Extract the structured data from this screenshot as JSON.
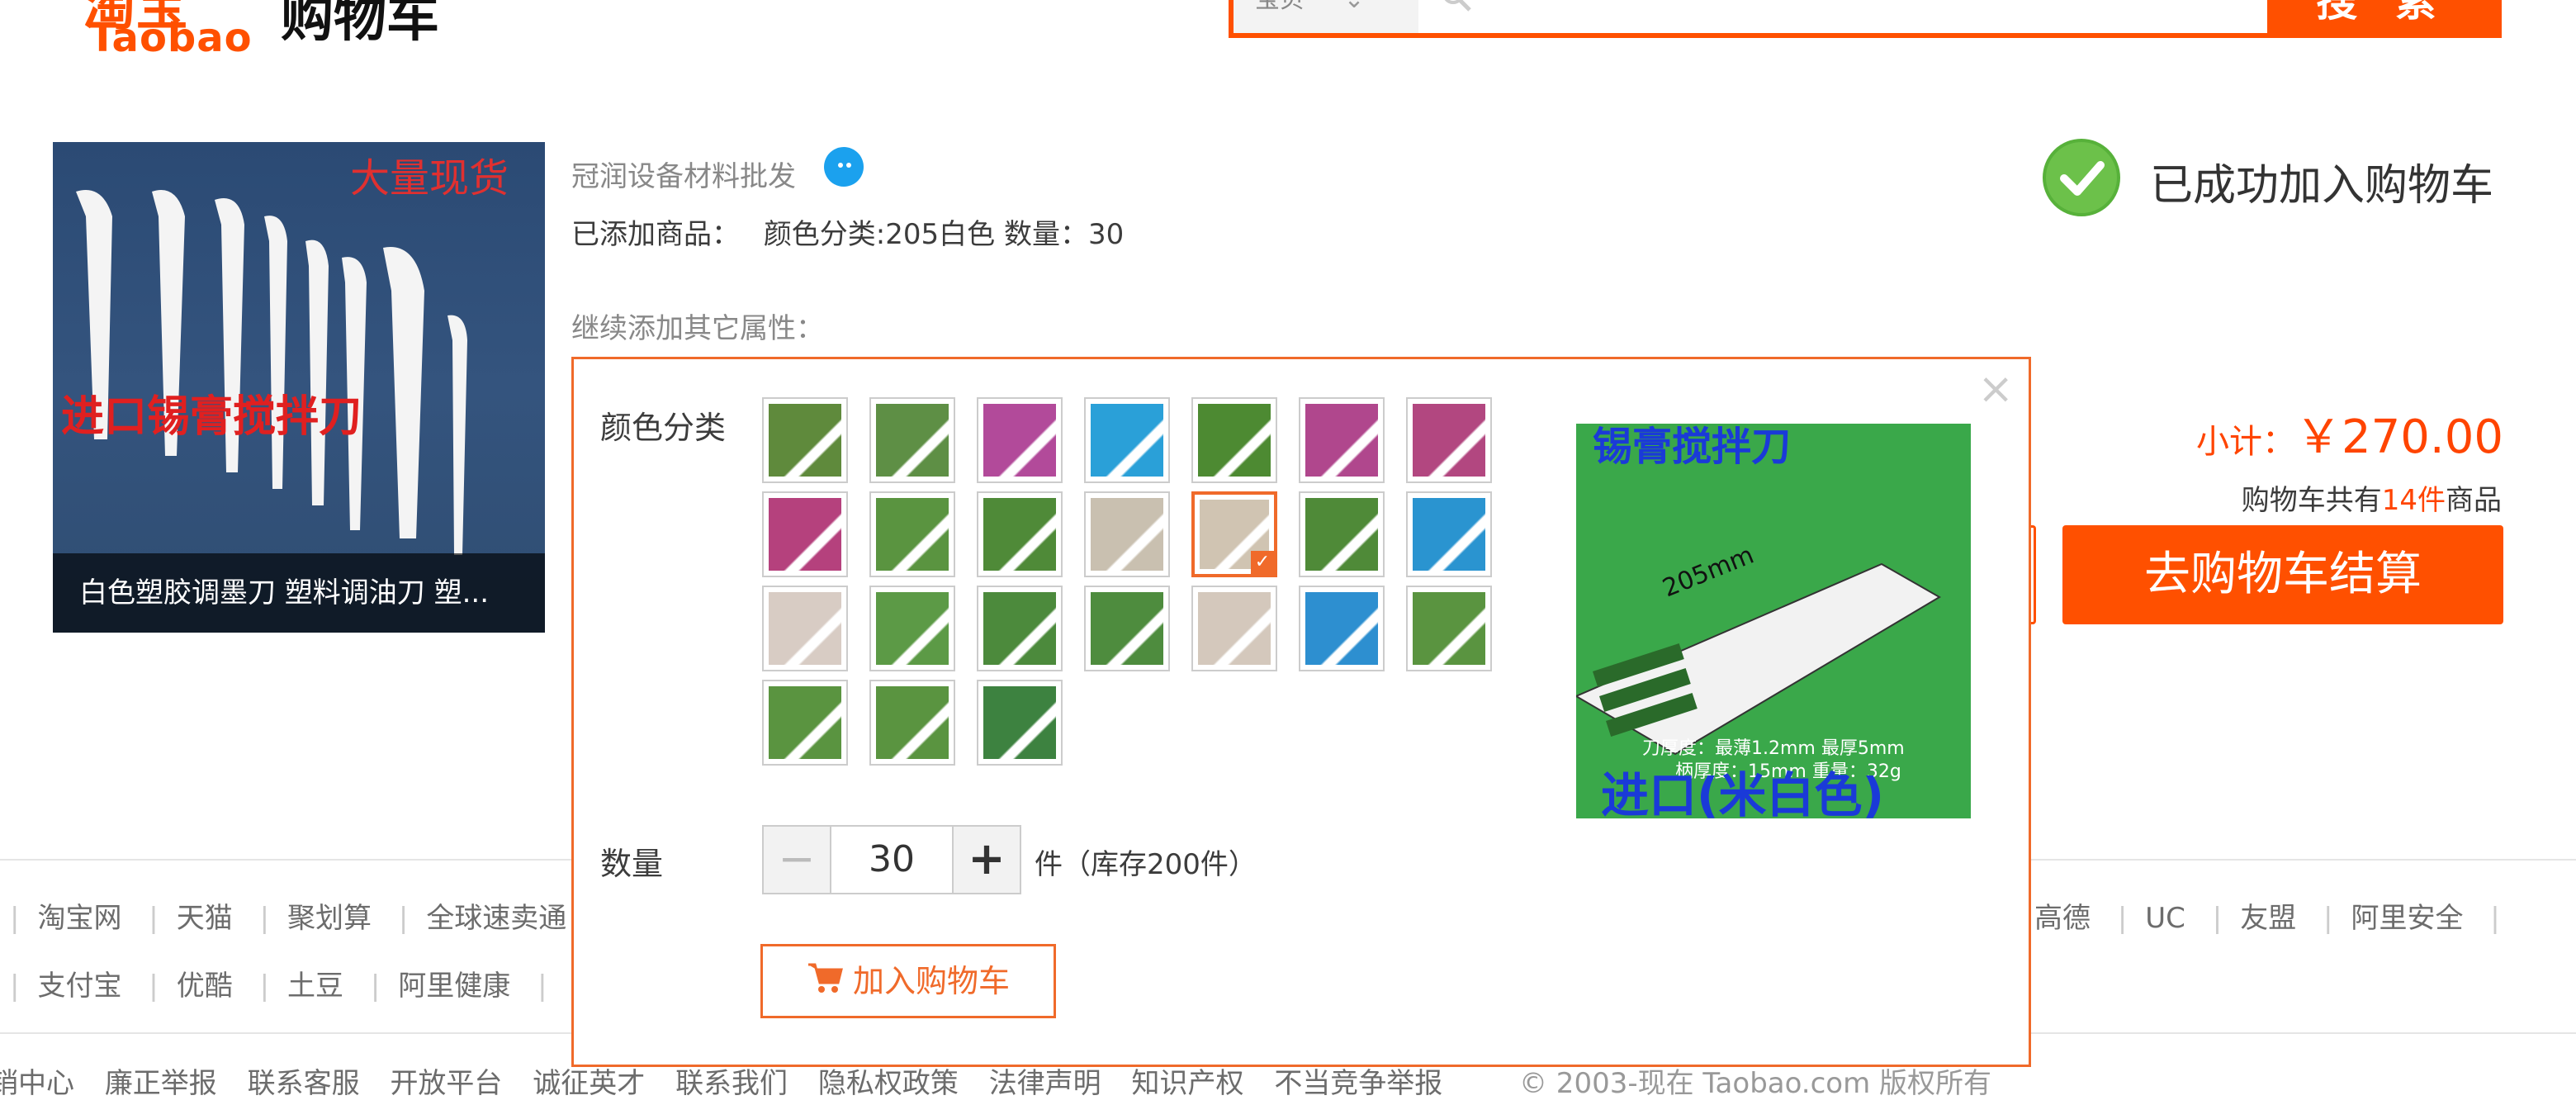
{
  "header": {
    "logo_en": "Taobao",
    "logo_cart": "购物车",
    "search_category": "宝贝",
    "search_button": "搜 索"
  },
  "product": {
    "caption": "白色塑胶调墨刀 塑料调油刀 塑...",
    "shop_name": "冠润设备材料批发",
    "added_label": "已添加商品：",
    "added_spec": "颜色分类:205白色 数量：30",
    "continue_label": "继续添加其它属性："
  },
  "success": {
    "text": "已成功加入购物车",
    "subtotal_label": "小计：",
    "subtotal_amount": "￥270.00",
    "cart_prefix": "购物车共有",
    "cart_count": "14件",
    "cart_suffix": "商品",
    "checkout": "去购物车结算"
  },
  "modal": {
    "color_label": "颜色分类",
    "qty_label": "数量",
    "qty_value": "30",
    "qty_minus": "−",
    "qty_plus": "+",
    "qty_unit": "件（库存200件）",
    "add_to_cart": "加入购物车",
    "close": "×",
    "thumb_colors": [
      "#5f8a3c",
      "#5e8f45",
      "#b24a9a",
      "#2aa0d8",
      "#4d8a32",
      "#b0478d",
      "#b24780",
      "#b5417d",
      "#5a9440",
      "#4f8a38",
      "#c9c0b0",
      "#d0c4b2",
      "#4f8a38",
      "#2a94d0",
      "#d8ccc4",
      "#5c9a46",
      "#4c8a3c",
      "#4e8c3e",
      "#d4c8bc",
      "#2d8fd0",
      "#5a9440",
      "#5a9440",
      "#5a9440",
      "#3d8240"
    ],
    "selected_index": 11
  },
  "footer": {
    "row1": [
      "淘宝网",
      "天猫",
      "聚划算",
      "全球速卖通",
      "高德",
      "UC",
      "友盟",
      "阿里安全"
    ],
    "row2": [
      "支付宝",
      "优酷",
      "土豆",
      "阿里健康"
    ],
    "row3": [
      "销中心",
      "廉正举报",
      "联系客服",
      "开放平台",
      "诚征英才",
      "联系我们",
      "隐私权政策",
      "法律声明",
      "知识产权",
      "不当竞争举报"
    ],
    "copyright": "© 2003-现在 Taobao.com 版权所有"
  }
}
